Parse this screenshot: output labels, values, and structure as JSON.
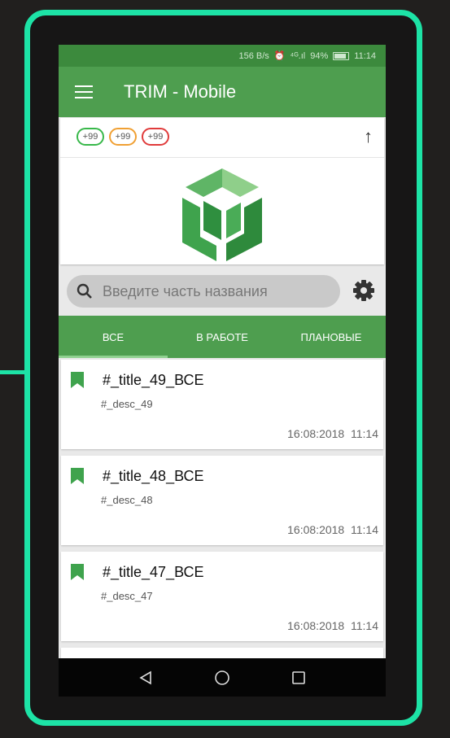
{
  "statusbar": {
    "speed": "156 B/s",
    "alarm": "⏰",
    "signal": "⁴ᴳ.ıl",
    "battery_pct": "94%",
    "time": "11:14"
  },
  "appbar": {
    "title": "TRIM - Mobile"
  },
  "badges": [
    {
      "text": "+99",
      "color": "#38b84a"
    },
    {
      "text": "+99",
      "color": "#f0a033"
    },
    {
      "text": "+99",
      "color": "#e03b3b"
    }
  ],
  "search": {
    "placeholder": "Введите часть названия"
  },
  "tabs": [
    "ВСЕ",
    "В РАБОТЕ",
    "ПЛАНОВЫЕ"
  ],
  "items": [
    {
      "title": "#_title_49_ВСЕ",
      "desc": "#_desc_49",
      "date": "16:08:2018",
      "time": "11:14"
    },
    {
      "title": "#_title_48_ВСЕ",
      "desc": "#_desc_48",
      "date": "16:08:2018",
      "time": "11:14"
    },
    {
      "title": "#_title_47_ВСЕ",
      "desc": "#_desc_47",
      "date": "16:08:2018",
      "time": "11:14"
    }
  ],
  "colors": {
    "accent": "#1de3a6",
    "primary": "#4e9e4f",
    "primary_dark": "#3c8a3d"
  }
}
